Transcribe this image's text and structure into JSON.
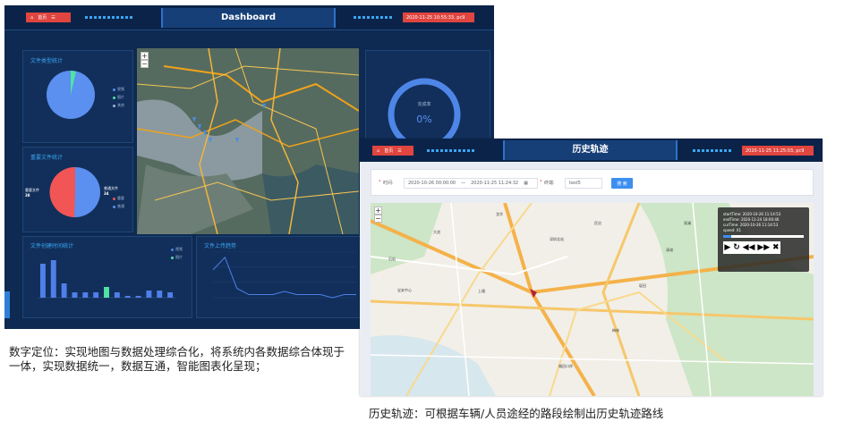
{
  "dashboard": {
    "home_label": "首页",
    "title": "Dashboard",
    "datetime": "2020-11-25 10:55:33, pc9",
    "file_type_panel": {
      "title": "文件类型统计",
      "legend": [
        "视频",
        "图片",
        "其他"
      ]
    },
    "important_panel": {
      "title": "重要文件统计",
      "left_label": "重要文件",
      "left_value": "38",
      "right_label": "普通文件",
      "right_value": "34",
      "legend": [
        "重要",
        "普通"
      ]
    },
    "gauge": {
      "label": "完成率",
      "value": "0%"
    },
    "created_panel": {
      "title": "文件创建时间统计",
      "legend": [
        "视频",
        "图片"
      ],
      "values": [
        19,
        21,
        8,
        3,
        3,
        3,
        6,
        3,
        1,
        1,
        4,
        4,
        3
      ],
      "ymax": 25
    },
    "upload_panel": {
      "title": "文件上传趋势",
      "values": [
        9,
        13,
        3,
        1,
        1,
        1,
        2,
        1,
        1,
        1,
        0,
        1,
        1
      ],
      "ymax": 15
    }
  },
  "history": {
    "home_label": "首页",
    "title": "历史轨迹",
    "datetime": "2020-11-25 11:25:03, pc9",
    "time_label": "时间:",
    "start_time": "2020-10-26 00:00:00",
    "range_sep": "—",
    "end_time": "2020-11-25 11:24:32",
    "terminal_label": "终端:",
    "terminal_value": "test5",
    "search_label": "搜 索",
    "info": [
      "startTime: 2020-10-26 11:14:53",
      "endTime: 2020-11-24 18:00:46",
      "curTime: 2020-10-26 11:14:53",
      "speed: X1"
    ],
    "place_labels": [
      "深圳北站",
      "福田口岸",
      "民治",
      "龙华",
      "宝安中心",
      "上塘",
      "坂田",
      "大浪",
      "清湖",
      "梅林",
      "石岩",
      "观澜"
    ]
  },
  "captions": {
    "left": "数字定位：实现地图与数据处理综合化，将系统内各数据综合体现于一体，实现数据统一，数据互通，智能图表化呈现；",
    "right": "历史轨迹：可根据车辆/人员途经的路段绘制出历史轨迹路线"
  },
  "colors": {
    "accent": "#39a7f2",
    "red": "#e0453f",
    "blue_bar": "#4f7fe8",
    "green": "#50e3a4"
  }
}
